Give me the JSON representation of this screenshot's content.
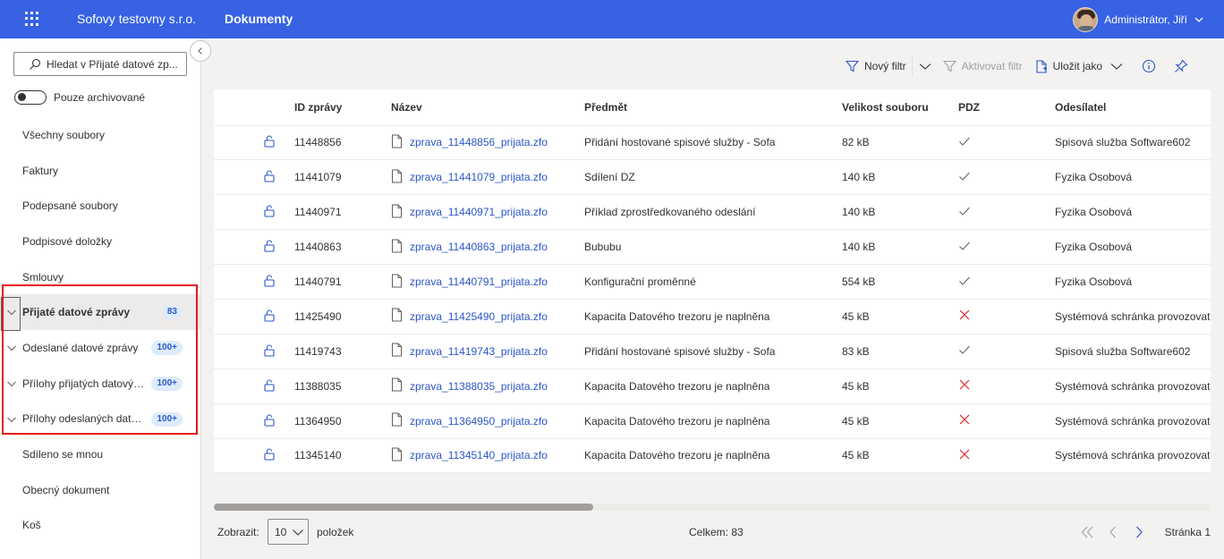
{
  "header": {
    "company": "Sofovy testovny s.r.o.",
    "module": "Dokumenty",
    "user": "Administrátor, Jiří"
  },
  "sidebar": {
    "search_placeholder": "Hledat v Přijaté datové zp...",
    "archive_toggle": "Pouze archivované",
    "items": [
      {
        "label": "Všechny soubory"
      },
      {
        "label": "Faktury"
      },
      {
        "label": "Podepsané soubory"
      },
      {
        "label": "Podpisové doložky"
      },
      {
        "label": "Smlouvy"
      },
      {
        "label": "Přijaté datové zprávy",
        "badge": "83"
      },
      {
        "label": "Odeslané datové zprávy",
        "badge": "100+"
      },
      {
        "label": "Přílohy přijatých datových zpráv",
        "badge": "100+"
      },
      {
        "label": "Přílohy odeslaných datových zpráv",
        "badge": "100+"
      },
      {
        "label": "Sdíleno se mnou"
      },
      {
        "label": "Obecný dokument"
      },
      {
        "label": "Koš"
      }
    ]
  },
  "toolbar": {
    "new_filter": "Nový filtr",
    "activate_filter": "Aktivovat filtr",
    "save_as": "Uložit jako"
  },
  "table": {
    "columns": [
      "ID zprávy",
      "Název",
      "Předmět",
      "Velikost souboru",
      "PDZ",
      "Odesílatel"
    ],
    "rows": [
      {
        "id": "11448856",
        "name": "zprava_11448856_prijata.zfo",
        "subject": "Přidání hostované spisové služby - Sofa",
        "size": "82 kB",
        "pdz": true,
        "sender": "Spisová služba Software602"
      },
      {
        "id": "11441079",
        "name": "zprava_11441079_prijata.zfo",
        "subject": "Sdílení DZ",
        "size": "140 kB",
        "pdz": true,
        "sender": "Fyzika Osobová"
      },
      {
        "id": "11440971",
        "name": "zprava_11440971_prijata.zfo",
        "subject": "Příklad zprostředkovaného odeslání",
        "size": "140 kB",
        "pdz": true,
        "sender": "Fyzika Osobová"
      },
      {
        "id": "11440863",
        "name": "zprava_11440863_prijata.zfo",
        "subject": "Bububu",
        "size": "140 kB",
        "pdz": true,
        "sender": "Fyzika Osobová"
      },
      {
        "id": "11440791",
        "name": "zprava_11440791_prijata.zfo",
        "subject": "Konfigurační proměnné",
        "size": "554 kB",
        "pdz": true,
        "sender": "Fyzika Osobová"
      },
      {
        "id": "11425490",
        "name": "zprava_11425490_prijata.zfo",
        "subject": "Kapacita Datového trezoru je naplněna",
        "size": "45 kB",
        "pdz": false,
        "sender": "Systémová schránka provozovatele"
      },
      {
        "id": "11419743",
        "name": "zprava_11419743_prijata.zfo",
        "subject": "Přidání hostované spisové služby - Sofa",
        "size": "83 kB",
        "pdz": true,
        "sender": "Spisová služba Software602"
      },
      {
        "id": "11388035",
        "name": "zprava_11388035_prijata.zfo",
        "subject": "Kapacita Datového trezoru je naplněna",
        "size": "45 kB",
        "pdz": false,
        "sender": "Systémová schránka provozovatele"
      },
      {
        "id": "11364950",
        "name": "zprava_11364950_prijata.zfo",
        "subject": "Kapacita Datového trezoru je naplněna",
        "size": "45 kB",
        "pdz": false,
        "sender": "Systémová schránka provozovatele"
      },
      {
        "id": "11345140",
        "name": "zprava_11345140_prijata.zfo",
        "subject": "Kapacita Datového trezoru je naplněna",
        "size": "45 kB",
        "pdz": false,
        "sender": "Systémová schránka provozovatele"
      }
    ]
  },
  "footer": {
    "show_label": "Zobrazit:",
    "page_size": "10",
    "items_label": "položek",
    "total": "Celkem: 83",
    "page": "Stránka 1"
  },
  "colors": {
    "brand": "#3662e3",
    "link": "#2b56c9",
    "error": "#e8161b"
  }
}
